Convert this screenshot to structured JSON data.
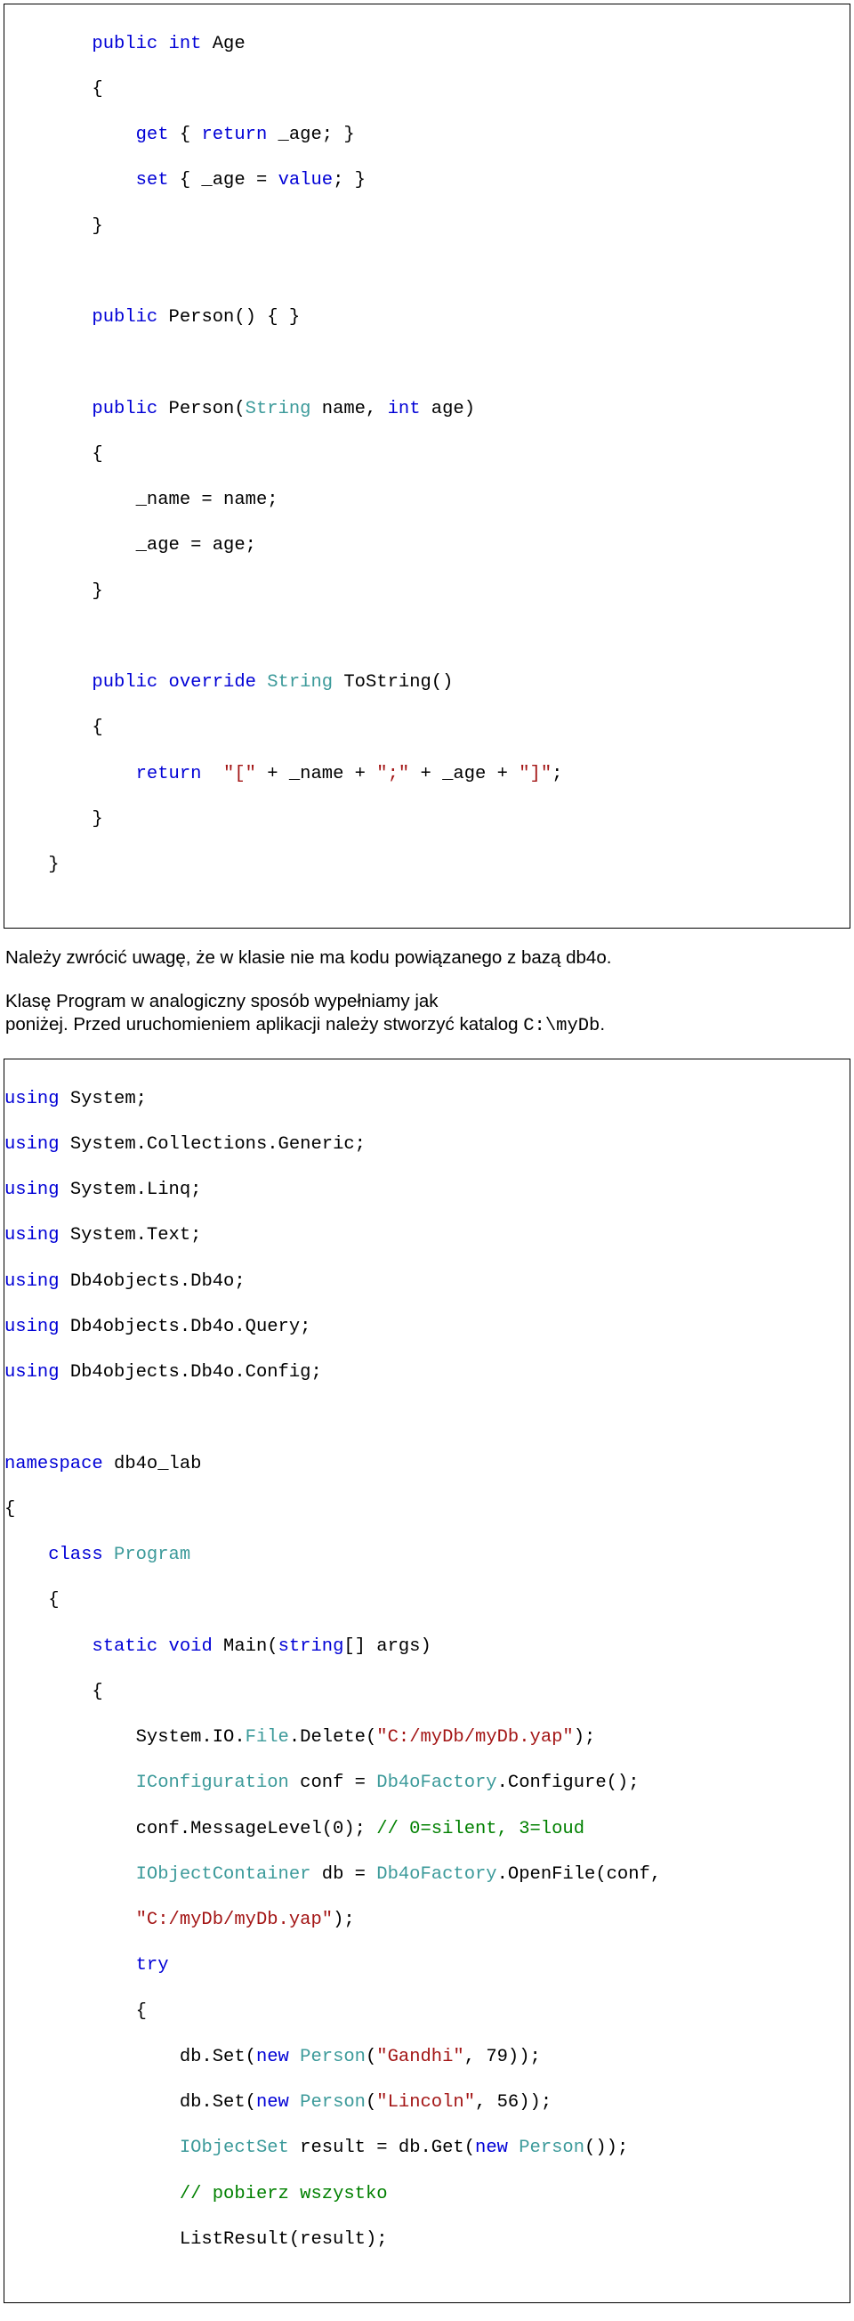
{
  "code1": {
    "l01a": "        public",
    "l01b": " int",
    "l01c": " Age",
    "l02": "        {",
    "l03a": "            get",
    "l03b": " { ",
    "l03c": "return",
    "l03d": " _age; }",
    "l04a": "            set",
    "l04b": " { _age = ",
    "l04c": "value",
    "l04d": "; }",
    "l05": "        }",
    "l06": " ",
    "l07a": "        public",
    "l07b": " Person() { }",
    "l08": " ",
    "l09a": "        public",
    "l09b": " Person(",
    "l09c": "String",
    "l09d": " name, ",
    "l09e": "int",
    "l09f": " age)",
    "l10": "        {",
    "l11": "            _name = name;",
    "l12": "            _age = age;",
    "l13": "        }",
    "l14": " ",
    "l15a": "        public",
    "l15b": " override",
    "l15c": " String",
    "l15d": " ToString()",
    "l16": "        {",
    "l17a": "            return",
    "l17b": " \"[\"",
    "l17c": " + _name + ",
    "l17d": "\";\"",
    "l17e": " + _age + ",
    "l17f": "\"]\"",
    "l17g": ";",
    "l18": "        }",
    "l19": "    }"
  },
  "prose": {
    "p1": "Należy zwrócić uwagę, że w klasie nie ma kodu powiązanego z bazą db4o.",
    "p2_line1": "Klasę Program w analogiczny sposób wypełniamy jak",
    "p2_line2a": "poniżej. Przed uruchomieniem aplikacji należy stworzyć katalog ",
    "p2_line2b": "C:\\myDb",
    "p2_line2c": "."
  },
  "code2": {
    "l01a": "using",
    "l01b": " System;",
    "l02a": "using",
    "l02b": " System.Collections.Generic;",
    "l03a": "using",
    "l03b": " System.Linq;",
    "l04a": "using",
    "l04b": " System.Text;",
    "l05a": "using",
    "l05b": " Db4objects.Db4o;",
    "l06a": "using",
    "l06b": " Db4objects.Db4o.Query;",
    "l07a": "using",
    "l07b": " Db4objects.Db4o.Config;",
    "l08": " ",
    "l09a": "namespace",
    "l09b": " db4o_lab",
    "l10": "{",
    "l11a": "    class",
    "l11b": " Program",
    "l12": "    {",
    "l13a": "        static",
    "l13b": " void",
    "l13c": " Main(",
    "l13d": "string",
    "l13e": "[] args)",
    "l14": "        {",
    "l15a": "            System.IO.",
    "l15b": "File",
    "l15c": ".Delete(",
    "l15d": "\"C:/myDb/myDb.yap\"",
    "l15e": ");",
    "l16a": "            ",
    "l16b": "IConfiguration",
    "l16c": " conf = ",
    "l16d": "Db4oFactory",
    "l16e": ".Configure();",
    "l17a": "            conf.MessageLevel(0); ",
    "l17b": "// 0=silent, 3=loud",
    "l18a": "            ",
    "l18b": "IObjectContainer",
    "l18c": " db = ",
    "l18d": "Db4oFactory",
    "l18e": ".OpenFile(conf,",
    "l19a": "            ",
    "l19b": "\"C:/myDb/myDb.yap\"",
    "l19c": ");",
    "l20a": "            ",
    "l20b": "try",
    "l21": "            {",
    "l22a": "                db.Set(",
    "l22b": "new",
    "l22c": " Person",
    "l22d": "(",
    "l22e": "\"Gandhi\"",
    "l22f": ", 79));",
    "l23a": "                db.Set(",
    "l23b": "new",
    "l23c": " Person",
    "l23d": "(",
    "l23e": "\"Lincoln\"",
    "l23f": ", 56));",
    "l24a": "                ",
    "l24b": "IObjectSet",
    "l24c": " result = db.Get(",
    "l24d": "new",
    "l24e": " Person",
    "l24f": "());",
    "l25a": "                ",
    "l25b": "// pobierz wszystko",
    "l26": "                ListResult(result);"
  }
}
